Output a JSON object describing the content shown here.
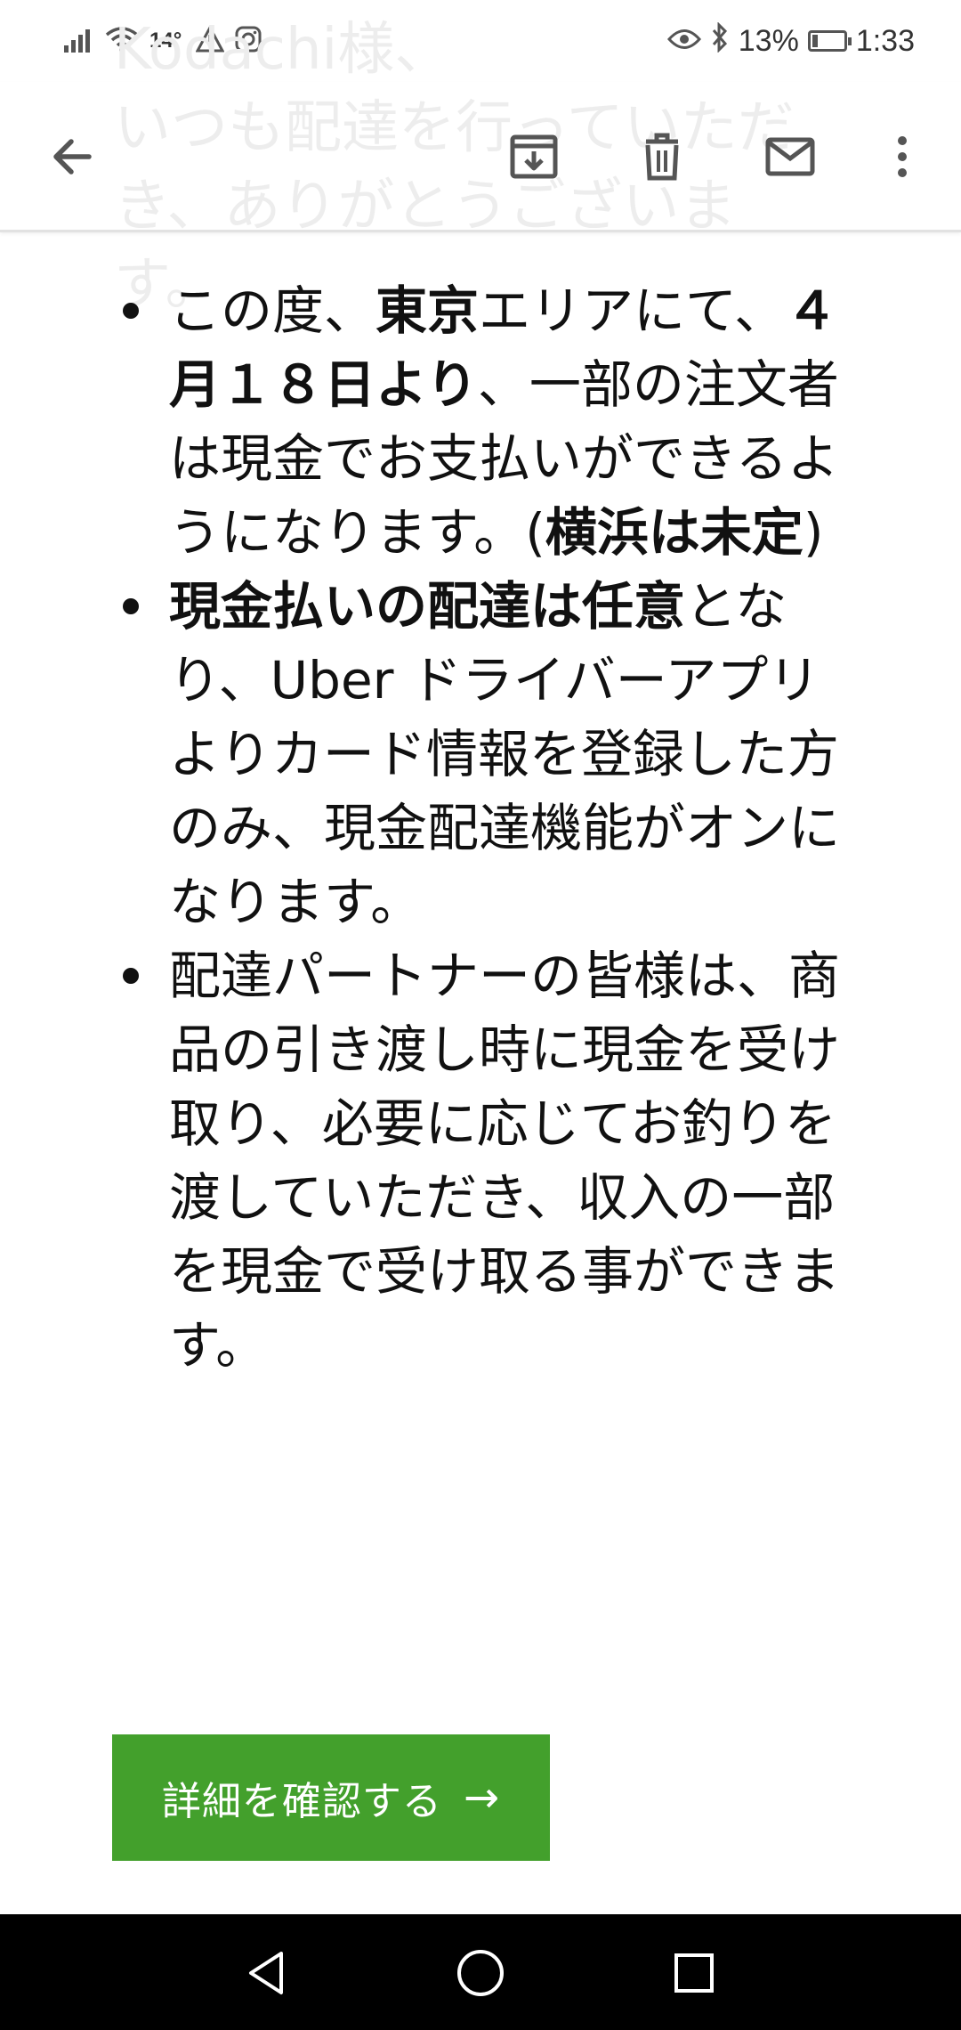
{
  "status_bar": {
    "temperature": "14°",
    "battery_percent": "13%",
    "time": "1:33"
  },
  "header": {
    "ghost_text": "Kodachi様、\nいつも配達を行っていただ\nき、ありがとうございます。"
  },
  "toolbar": {
    "icons": [
      "back-arrow-icon",
      "archive-icon",
      "delete-icon",
      "mail-icon",
      "more-vert-icon"
    ]
  },
  "email": {
    "bullet1": {
      "t1": "この度、",
      "b1": "東京",
      "t2": "エリアにて、",
      "b2": "４月１８日より",
      "t3": "、一部の注文者は現金でお支払いができるようになります。(",
      "b3": "横浜は未定",
      "t4": ")"
    },
    "bullet2": {
      "b1": "現金払いの配達は任意",
      "t1": "となり、Uber ドライバーアプリよりカード情報を登録した方のみ、現金配達機能がオンになります。"
    },
    "bullet3": {
      "t1": "配達パートナーの皆様は、商品の引き渡し時に現金を受け取り、必要に応じてお釣りを渡していただき、収入の一部を現金で受け取る事ができます。"
    },
    "cta_label": "詳細を確認する",
    "cta_arrow": "→"
  },
  "colors": {
    "cta_background": "#43a02c",
    "nav_background": "#000000"
  }
}
